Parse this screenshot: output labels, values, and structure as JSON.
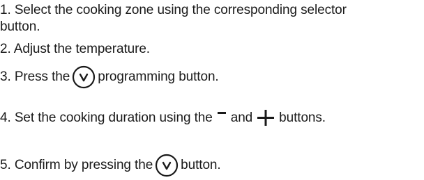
{
  "steps": [
    {
      "text_a": "1. Select the cooking zone using the corresponding selector",
      "text_b": "button."
    },
    {
      "text": "2. Adjust the temperature."
    },
    {
      "before": "3. Press the",
      "after": "programming button.",
      "icon": "check-circle-icon"
    },
    {
      "before": "4. Set the cooking duration using the",
      "middle": "and",
      "after": "buttons.",
      "icon_minus": "minus-icon",
      "icon_plus": "plus-icon"
    },
    {
      "before": "5. Confirm by pressing the",
      "after": "button.",
      "icon": "check-circle-icon"
    }
  ],
  "colors": {
    "text": "#1a1a1a",
    "background": "#ffffff"
  }
}
